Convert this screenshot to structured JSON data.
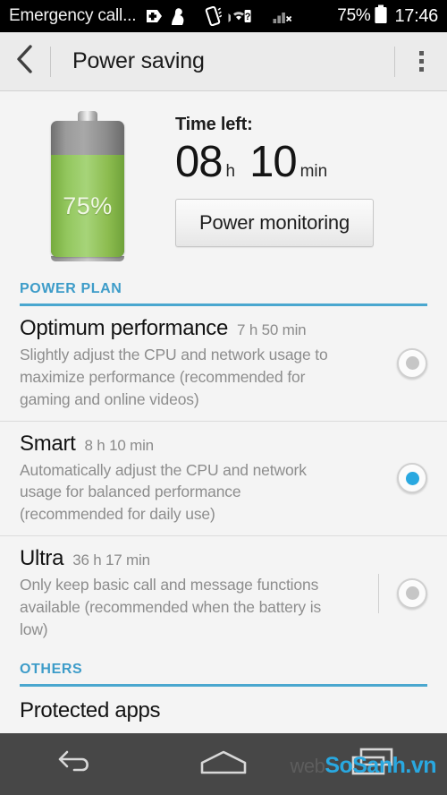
{
  "status_bar": {
    "carrier": "Emergency call...",
    "battery_percent": "75%",
    "clock": "17:46",
    "icons": [
      "first-aid-plus-icon",
      "bluetooth-audio-icon",
      "vibrate-icon",
      "wifi-question-icon",
      "signal-no-service-icon",
      "battery-icon"
    ]
  },
  "action_bar": {
    "back_icon": "chevron-left-icon",
    "title": "Power saving",
    "overflow_icon": "overflow-menu-icon"
  },
  "battery": {
    "percent_label": "75%",
    "fill_percent": 75,
    "fill_color": "#8cbc4f",
    "body_color": "#9b9b9b"
  },
  "time_left": {
    "label": "Time left:",
    "hours": "08",
    "hours_unit": "h",
    "minutes": "10",
    "minutes_unit": "min"
  },
  "power_monitoring_button": {
    "label": "Power monitoring"
  },
  "sections": {
    "power_plan": {
      "title": "POWER PLAN",
      "accent_color": "#4aa7cf"
    },
    "others": {
      "title": "OTHERS",
      "accent_color": "#4aa7cf"
    }
  },
  "plans": [
    {
      "name": "Optimum performance",
      "time": "7 h 50 min",
      "description": "Slightly adjust the CPU and network usage to maximize performance (recommended for gaming and online videos)",
      "selected": false
    },
    {
      "name": "Smart",
      "time": "8 h 10 min",
      "description": "Automatically adjust the CPU and network usage for balanced performance (recommended for daily use)",
      "selected": true
    },
    {
      "name": "Ultra",
      "time": "36 h 17 min",
      "description": "Only keep basic call and message functions available (recommended when the battery is low)",
      "selected": false
    }
  ],
  "others_items": [
    {
      "label": "Protected apps"
    }
  ],
  "nav_bar": {
    "back_icon": "nav-back-icon",
    "home_icon": "nav-home-icon",
    "recents_icon": "nav-recents-icon"
  },
  "watermark": {
    "prefix": "web",
    "text": "SoSanh.vn",
    "color": "#29a8e0"
  },
  "selected_radio_color": "#29a8e0",
  "unselected_radio_color": "#c6c6c6"
}
